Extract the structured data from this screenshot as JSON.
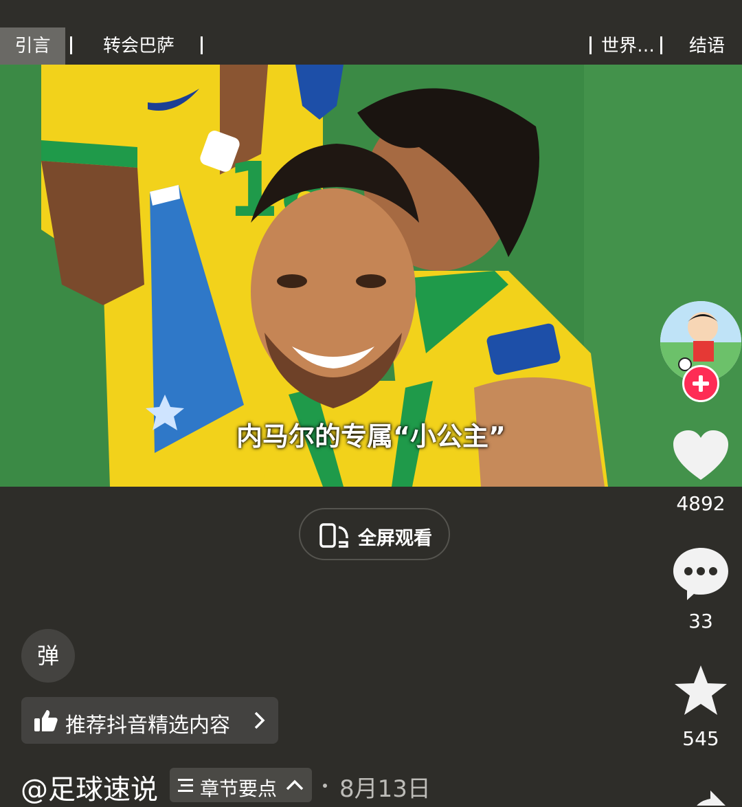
{
  "chapters": {
    "items": [
      "引言",
      "转会巴萨",
      "世界…",
      "结语"
    ],
    "active": "引言"
  },
  "video": {
    "subtitle": "内马尔的专属“小公主”"
  },
  "fullscreen": {
    "label": "全屏观看"
  },
  "rail": {
    "likes": "4892",
    "comments": "33",
    "favorites": "545"
  },
  "danmaku": {
    "label": "弹"
  },
  "recommend": {
    "label": "推荐抖音精选内容"
  },
  "meta": {
    "author": "@足球速说",
    "chapters_label": "章节要点",
    "date": "8月13日"
  },
  "colors": {
    "background": "#2e2d29",
    "follow_badge": "#fe2c55",
    "jersey_yellow": "#f2d21b",
    "pitch_green": "#3b8a45"
  }
}
